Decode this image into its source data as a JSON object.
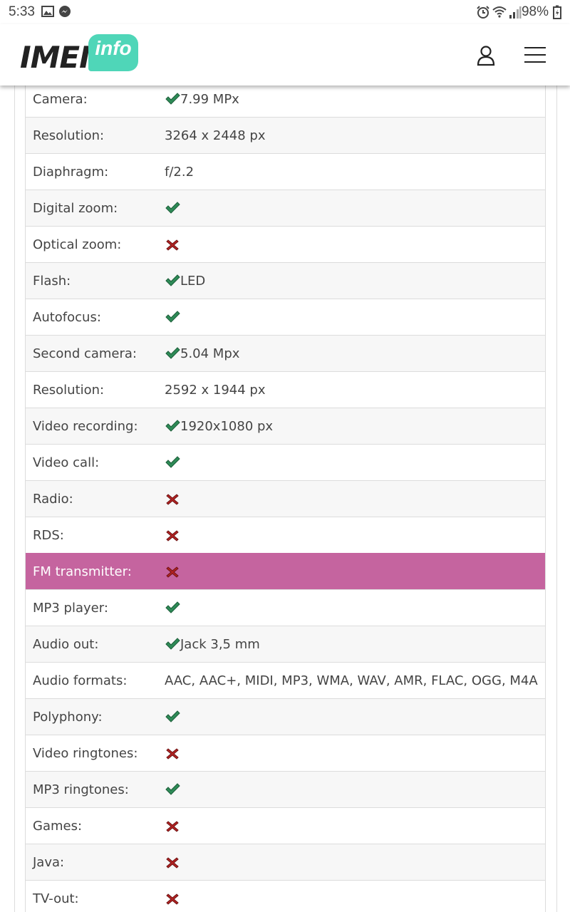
{
  "status_bar": {
    "time": "5:33",
    "battery": "98%"
  },
  "header": {
    "logo_main": "IMEI",
    "logo_sub": "info"
  },
  "colors": {
    "highlight_row": "#c5649f",
    "check": "#2e8b57",
    "cross": "#b22222",
    "logo_accent": "#4fd6b8"
  },
  "specs": [
    {
      "label": "Camera:",
      "mark": "check",
      "text": "7.99 MPx"
    },
    {
      "label": "Resolution:",
      "mark": "",
      "text": "3264 x 2448 px"
    },
    {
      "label": "Diaphragm:",
      "mark": "",
      "text": "f/2.2"
    },
    {
      "label": "Digital zoom:",
      "mark": "check",
      "text": ""
    },
    {
      "label": "Optical zoom:",
      "mark": "cross",
      "text": ""
    },
    {
      "label": "Flash:",
      "mark": "check",
      "text": "LED"
    },
    {
      "label": "Autofocus:",
      "mark": "check",
      "text": ""
    },
    {
      "label": "Second camera:",
      "mark": "check",
      "text": "5.04 Mpx"
    },
    {
      "label": "Resolution:",
      "mark": "",
      "text": "2592 x 1944 px"
    },
    {
      "label": "Video recording:",
      "mark": "check",
      "text": "1920x1080 px"
    },
    {
      "label": "Video call:",
      "mark": "check",
      "text": ""
    },
    {
      "label": "Radio:",
      "mark": "cross",
      "text": ""
    },
    {
      "label": "RDS:",
      "mark": "cross",
      "text": ""
    },
    {
      "label": "FM transmitter:",
      "mark": "cross",
      "text": "",
      "highlight": true
    },
    {
      "label": "MP3 player:",
      "mark": "check",
      "text": ""
    },
    {
      "label": "Audio out:",
      "mark": "check",
      "text": "Jack 3,5 mm"
    },
    {
      "label": "Audio formats:",
      "mark": "",
      "text": "AAC, AAC+, MIDI, MP3, WMA, WAV, AMR, FLAC, OGG, M4A"
    },
    {
      "label": "Polyphony:",
      "mark": "check",
      "text": ""
    },
    {
      "label": "Video ringtones:",
      "mark": "cross",
      "text": ""
    },
    {
      "label": "MP3 ringtones:",
      "mark": "check",
      "text": ""
    },
    {
      "label": "Games:",
      "mark": "cross",
      "text": ""
    },
    {
      "label": "Java:",
      "mark": "cross",
      "text": ""
    },
    {
      "label": "TV-out:",
      "mark": "cross",
      "text": ""
    }
  ]
}
